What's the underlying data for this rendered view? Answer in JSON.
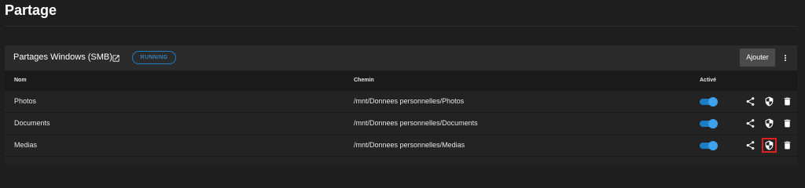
{
  "page": {
    "title": "Partage"
  },
  "card": {
    "title": "Partages Windows (SMB)",
    "status": "RUNNING",
    "add_label": "Ajouter"
  },
  "table": {
    "columns": [
      "Nom",
      "Chemin",
      "Activé"
    ],
    "rows": [
      {
        "name": "Photos",
        "path": "/mnt/Donnees personnelles/Photos",
        "enabled": true
      },
      {
        "name": "Documents",
        "path": "/mnt/Donnees personnelles/Documents",
        "enabled": true
      },
      {
        "name": "Medias",
        "path": "/mnt/Donnees personnelles/Medias",
        "enabled": true
      }
    ]
  },
  "icons": {
    "title_link": "external-link-icon",
    "menu": "more-vert-icon",
    "row_actions": [
      "share-icon",
      "security-shield-icon",
      "delete-icon"
    ]
  },
  "colors": {
    "accent": "#1a7cc4",
    "highlight": "#e02020"
  }
}
